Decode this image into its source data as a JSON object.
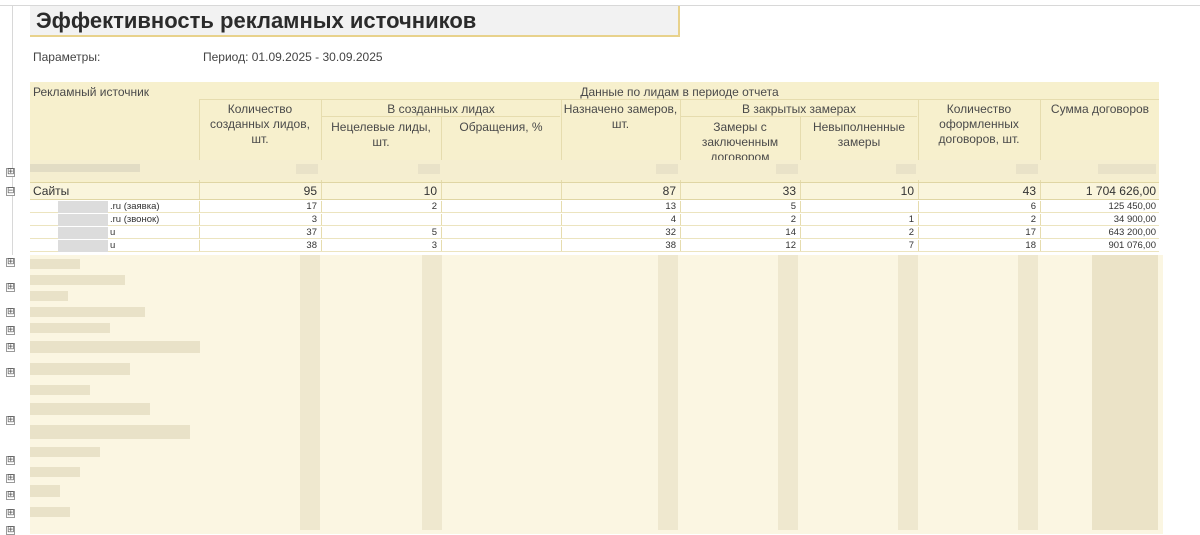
{
  "report": {
    "title": "Эффективность рекламных источников",
    "params_label": "Параметры:",
    "period": "Период: 01.09.2025 - 30.09.2025"
  },
  "headers": {
    "source": "Рекламный источник",
    "leads_group": "Данные по лидам в периоде отчета",
    "created_leads": "Количество созданных лидов, шт.",
    "in_created_leads": "В созданных лидах",
    "nontarget": "Нецелевые лиды, шт.",
    "appeals": "Обращения, %",
    "assigned_measurements": "Назначено замеров, шт.",
    "in_closed_measurements": "В закрытых замерах",
    "measurements_with_contract": "Замеры с заключенным договором",
    "unfulfilled": "Невыполненные замеры",
    "contracts_count": "Количество оформленных договоров, шт.",
    "contracts_sum": "Сумма договоров"
  },
  "group": {
    "name": "Сайты",
    "created": "95",
    "nontarget": "10",
    "appeals": "",
    "assigned": "87",
    "with_contract": "33",
    "unfulfilled": "10",
    "contracts": "43",
    "sum": "1 704 626,00"
  },
  "rows": [
    {
      "source": ".ru (заявка)",
      "created": "17",
      "nontarget": "2",
      "appeals": "",
      "assigned": "13",
      "with_contract": "5",
      "unfulfilled": "",
      "contracts": "6",
      "sum": "125 450,00"
    },
    {
      "source": ".ru (звонок)",
      "created": "3",
      "nontarget": "",
      "appeals": "",
      "assigned": "4",
      "with_contract": "2",
      "unfulfilled": "1",
      "contracts": "2",
      "sum": "34 900,00"
    },
    {
      "source": "u",
      "created": "37",
      "nontarget": "5",
      "appeals": "",
      "assigned": "32",
      "with_contract": "14",
      "unfulfilled": "2",
      "contracts": "17",
      "sum": "643 200,00"
    },
    {
      "source": "u",
      "created": "38",
      "nontarget": "3",
      "appeals": "",
      "assigned": "38",
      "with_contract": "12",
      "unfulfilled": "7",
      "contracts": "18",
      "sum": "901 076,00"
    }
  ],
  "icons": {
    "expand": "⊞",
    "collapse": "⊟"
  }
}
